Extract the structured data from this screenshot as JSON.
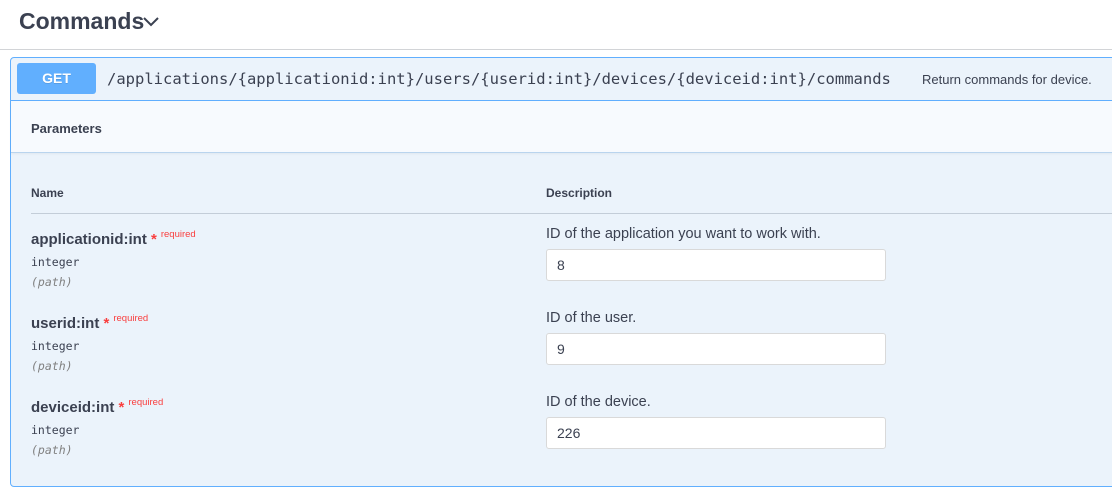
{
  "header": {
    "title": "Commands",
    "toggle_icon": "chevron-down-icon"
  },
  "operation": {
    "method": "GET",
    "path": "/applications/{applicationid:int}/users/{userid:int}/devices/{deviceid:int}/commands",
    "summary": "Return commands for device.",
    "accent_color": "#61affe"
  },
  "parameters": {
    "section_title": "Parameters",
    "col_name": "Name",
    "col_description": "Description",
    "items": [
      {
        "name": "applicationid:int",
        "required_mark": "*",
        "required_label": "required",
        "type": "integer",
        "in": "(path)",
        "description": "ID of the application you want to work with.",
        "value": "8"
      },
      {
        "name": "userid:int",
        "required_mark": "*",
        "required_label": "required",
        "type": "integer",
        "in": "(path)",
        "description": "ID of the user.",
        "value": "9"
      },
      {
        "name": "deviceid:int",
        "required_mark": "*",
        "required_label": "required",
        "type": "integer",
        "in": "(path)",
        "description": "ID of the device.",
        "value": "226"
      }
    ]
  }
}
